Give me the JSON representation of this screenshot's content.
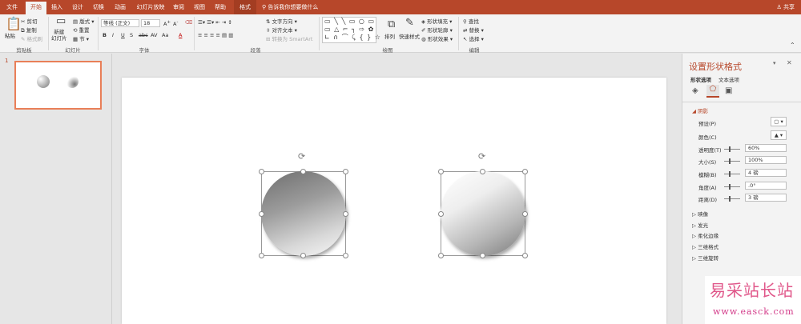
{
  "tabs": [
    "文件",
    "开始",
    "插入",
    "设计",
    "切换",
    "动画",
    "幻灯片放映",
    "审阅",
    "视图",
    "帮助",
    "格式"
  ],
  "search_text": "告诉我你想要做什么",
  "share_label": "共享",
  "ribbon": {
    "clipboard": {
      "paste": "粘贴",
      "cut": "剪切",
      "copy": "复制",
      "format_painter": "格式刷",
      "group": "剪贴板"
    },
    "slides": {
      "new_slide": "新建\n幻灯片",
      "layout": "版式",
      "reset": "重置",
      "section": "节",
      "group": "幻灯片"
    },
    "font": {
      "name": "等线 (正文)",
      "size": "18",
      "group": "字体",
      "buttons": [
        "B",
        "I",
        "U",
        "S",
        "abc",
        "AV",
        "Aa",
        "A"
      ]
    },
    "paragraph": {
      "text_direction": "文字方向",
      "align_text": "对齐文本",
      "smartart": "转换为 SmartArt",
      "group": "段落"
    },
    "drawing": {
      "arrange": "排列",
      "quick_styles": "快速样式",
      "fill": "形状填充",
      "outline": "形状轮廓",
      "effects": "形状效果",
      "group": "绘图"
    },
    "editing": {
      "find": "查找",
      "replace": "替换",
      "select": "选择",
      "group": "编辑"
    }
  },
  "thumbnail": {
    "number": "1"
  },
  "pane": {
    "title": "设置形状格式",
    "tab_shape": "形状选项",
    "tab_text": "文本选项",
    "section_open": "阴影",
    "rows": [
      {
        "label": "预设(P)",
        "value": ""
      },
      {
        "label": "颜色(C)",
        "value": ""
      },
      {
        "label": "透明度(T)",
        "value": "60%"
      },
      {
        "label": "大小(S)",
        "value": "100%"
      },
      {
        "label": "模糊(B)",
        "value": "4 磅"
      },
      {
        "label": "角度(A)",
        "value": ".0°"
      },
      {
        "label": "距离(D)",
        "value": "3 磅"
      }
    ],
    "sections": [
      "映像",
      "发光",
      "柔化边缘",
      "三维格式",
      "三维旋转"
    ]
  },
  "watermark": {
    "title": "易采站长站",
    "url": "www.easck.com"
  },
  "colors": {
    "accent": "#b7472a",
    "selection": "#e97f58"
  }
}
